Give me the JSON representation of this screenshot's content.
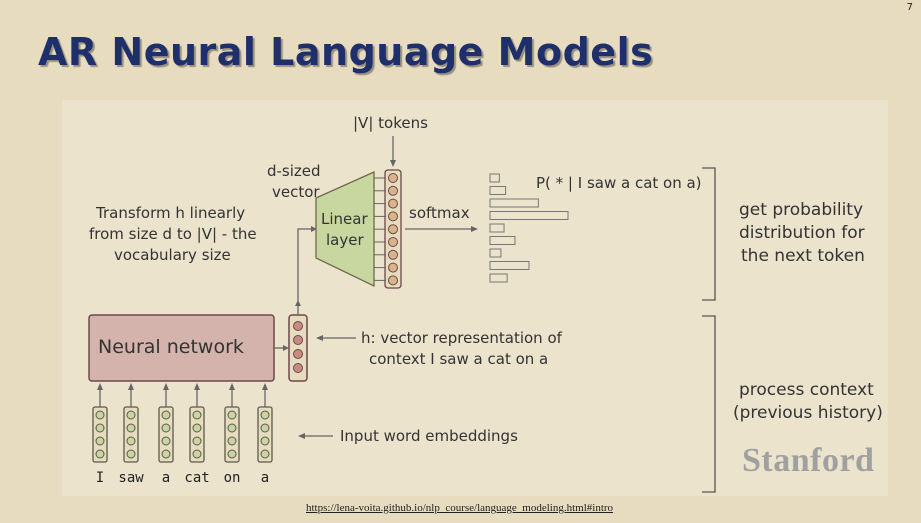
{
  "slide": {
    "title": "AR Neural Language Models",
    "page_number": "7",
    "link": "https://lena-voita.github.io/nlp_course/language_modeling.html#intro",
    "logo": "Stanford"
  },
  "diagram": {
    "vocab_tokens": "|V| tokens",
    "d_sized_line1": "d-sized",
    "d_sized_line2": "vector",
    "transform_line1": "Transform h linearly",
    "transform_line2": "from size d to |V| - the",
    "transform_line3": "vocabulary size",
    "linear_line1": "Linear",
    "linear_line2": "layer",
    "softmax": "softmax",
    "probability": "P( * | I saw a cat on a)",
    "get_prob_line1": "get probability",
    "get_prob_line2": "distribution for",
    "get_prob_line3": "the next token",
    "neural_network": "Neural network",
    "h_line1": "h: vector representation of",
    "h_line2": "context I saw a cat on a",
    "process_line1": "process context",
    "process_line2": "(previous history)",
    "embeddings": "Input word embeddings",
    "words": [
      "I",
      "saw",
      "a",
      "cat",
      "on",
      "a"
    ],
    "prob_bars": [
      0.12,
      0.2,
      0.62,
      1.0,
      0.18,
      0.32,
      0.14,
      0.5,
      0.22
    ]
  }
}
